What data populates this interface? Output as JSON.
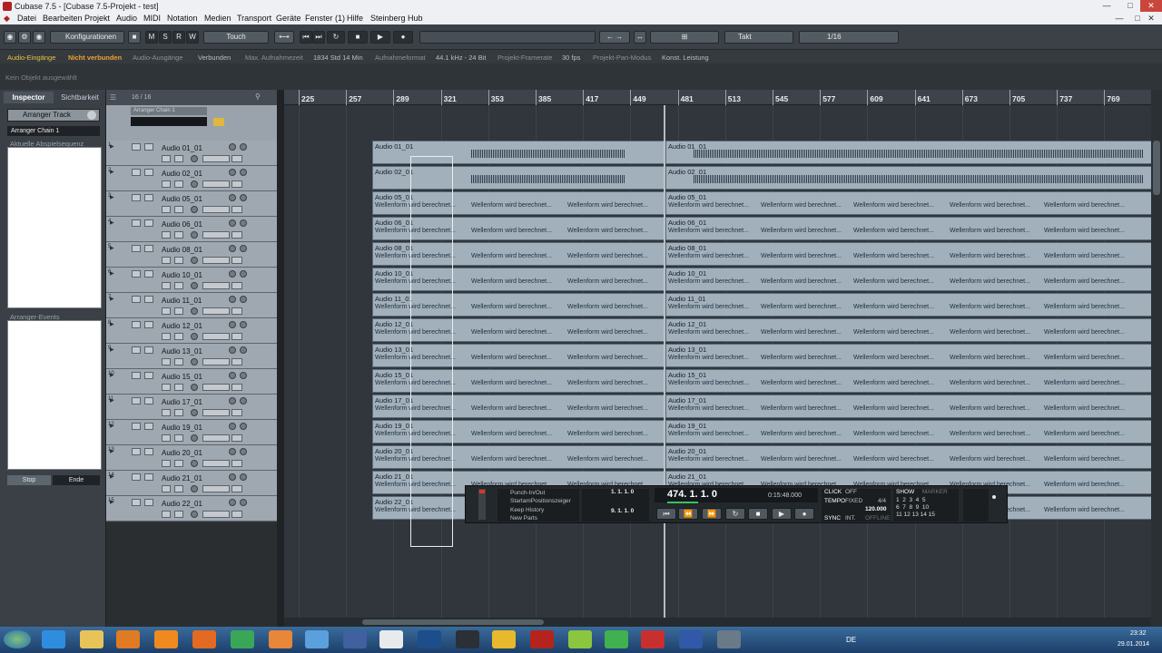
{
  "window": {
    "title": "Cubase 7.5 - [Cubase 7.5-Projekt - test]"
  },
  "menu": [
    "Datei",
    "Bearbeiten",
    "Projekt",
    "Audio",
    "MIDI",
    "Notation",
    "Medien",
    "Transport",
    "Geräte",
    "Fenster (1)",
    "Hilfe",
    "Steinberg Hub"
  ],
  "toolbar": {
    "config_label": "Konfigurationen",
    "msrw": [
      "M",
      "S",
      "R",
      "W"
    ],
    "automation_mode": "Touch",
    "grid_type": "Takt",
    "quantize": "1/16"
  },
  "status": {
    "audio_in_label": "Audio-Eingänge",
    "audio_in_value": "Nicht verbunden",
    "audio_out_label": "Audio-Ausgänge",
    "audio_out_value": "Verbunden",
    "rec_time_label": "Max. Aufnahmezeit",
    "rec_time_value": "1834 Std 14 Min",
    "rec_format_label": "Aufnahmeformat",
    "rec_format_value": "44.1 kHz - 24 Bit",
    "framerate_label": "Projekt-Framerate",
    "framerate_value": "30 fps",
    "pan_label": "Projekt-Pan-Modus",
    "pan_value": "Konst. Leistung"
  },
  "info": {
    "no_object": "Kein Objekt ausgewählt"
  },
  "inspector": {
    "tabs": [
      "Inspector",
      "Sichtbarkeit"
    ],
    "arranger_track": "Arranger Track",
    "chain_select": "Arranger Chain 1",
    "section_current": "Aktuelle Abspielsequenz",
    "section_events": "Arranger-Events",
    "stop_label": "Stop",
    "end_label": "Ende"
  },
  "tracklist": {
    "count": "16 / 16",
    "chain_name": "Arranger Chain 1"
  },
  "ruler": [
    "225",
    "257",
    "289",
    "321",
    "353",
    "385",
    "417",
    "449",
    "481",
    "513",
    "545",
    "577",
    "609",
    "641",
    "673",
    "705",
    "737",
    "769"
  ],
  "tracks": [
    {
      "num": "1",
      "name": "Audio 01_01"
    },
    {
      "num": "2",
      "name": "Audio 02_01"
    },
    {
      "num": "3",
      "name": "Audio 05_01"
    },
    {
      "num": "4",
      "name": "Audio 06_01"
    },
    {
      "num": "5",
      "name": "Audio 08_01"
    },
    {
      "num": "6",
      "name": "Audio 10_01"
    },
    {
      "num": "7",
      "name": "Audio 11_01"
    },
    {
      "num": "8",
      "name": "Audio 12_01"
    },
    {
      "num": "9",
      "name": "Audio 13_01"
    },
    {
      "num": "10",
      "name": "Audio 15_01"
    },
    {
      "num": "11",
      "name": "Audio 17_01"
    },
    {
      "num": "12",
      "name": "Audio 19_01"
    },
    {
      "num": "13",
      "name": "Audio 20_01"
    },
    {
      "num": "14",
      "name": "Audio 21_01"
    },
    {
      "num": "15",
      "name": "Audio 22_01"
    }
  ],
  "wave_text": "Wellenform wird berechnet...",
  "transport": {
    "punch": "Punch-In/Out",
    "start_pos": "StartamPositionszeiger",
    "keep": "Keep History",
    "new_parts": "New Parts",
    "left_loc": "1. 1. 1.   0",
    "right_loc": "9. 1. 1.   0",
    "position": "474. 1. 1.   0",
    "time": "0:15:48.000",
    "click": "CLICK",
    "click_val": "OFF",
    "tempo": "TEMPO",
    "tempo_mode": "FIXED",
    "signature": "4/4",
    "tempo_val": "120.000",
    "sync": "SYNC",
    "sync_mode": "INT.",
    "sync_state": "OFFLINE",
    "show": "SHOW",
    "marker": "MARKER"
  },
  "tray": {
    "lang": "DE",
    "time": "23:32",
    "date": "29.01.2014"
  }
}
